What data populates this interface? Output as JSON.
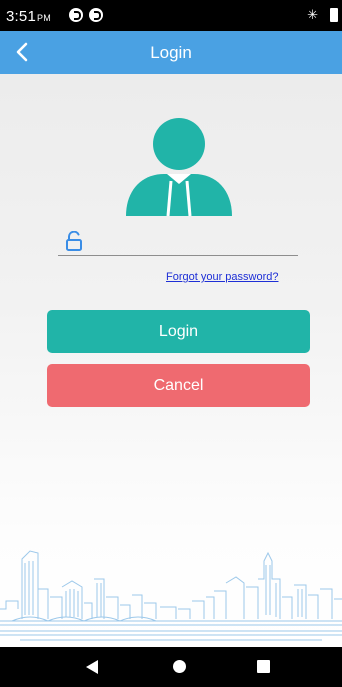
{
  "status_bar": {
    "time": "3:51",
    "ampm": "PM",
    "icons": [
      "notification-icon",
      "notification-icon",
      "bluetooth-icon",
      "battery-icon"
    ]
  },
  "header": {
    "title": "Login",
    "back_icon": "chevron-left-icon"
  },
  "form": {
    "avatar_icon": "user-avatar-icon",
    "password_icon": "lock-icon",
    "password_value": "",
    "password_placeholder": "",
    "forgot_link": "Forgot your password?",
    "login_label": "Login",
    "cancel_label": "Cancel"
  },
  "colors": {
    "header": "#4aa1e3",
    "accent": "#21b4a8",
    "cancel": "#ef6a70",
    "link": "#1e2fd6",
    "skyline": "#9cc8ea"
  },
  "nav_bar": {
    "icons": [
      "back-triangle-icon",
      "home-circle-icon",
      "recent-apps-square-icon"
    ]
  }
}
